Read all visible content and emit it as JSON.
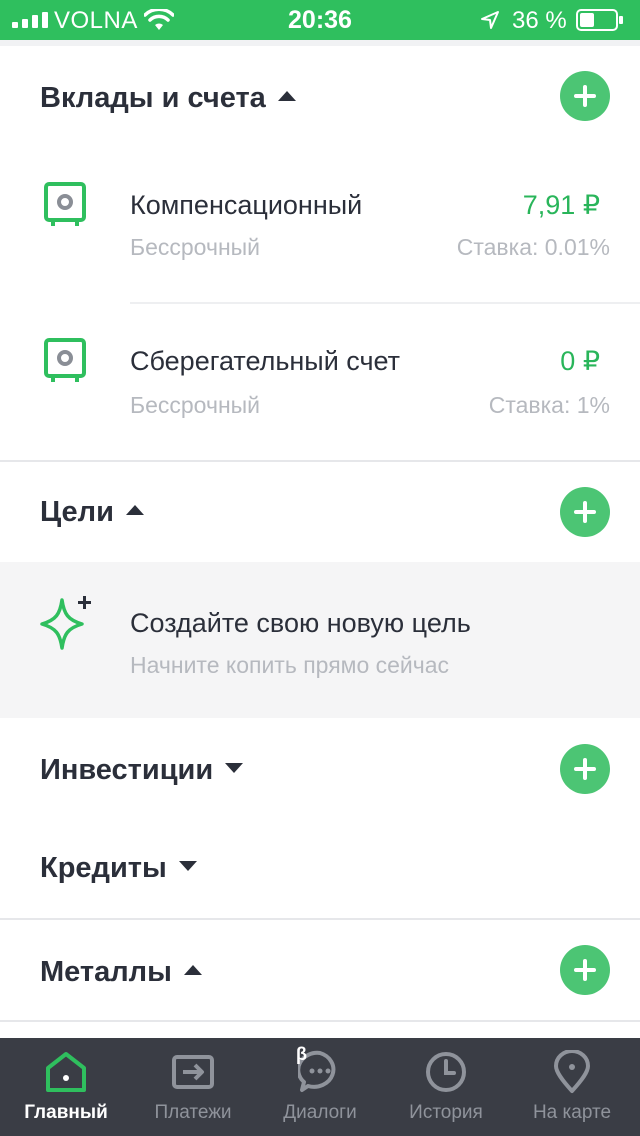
{
  "status_bar": {
    "carrier": "VOLNA",
    "time": "20:36",
    "battery": "36 %"
  },
  "sections": {
    "deposits": {
      "title": "Вклады и счета"
    },
    "goals": {
      "title": "Цели"
    },
    "investments": {
      "title": "Инвестиции"
    },
    "credits": {
      "title": "Кредиты"
    },
    "metals": {
      "title": "Металлы"
    }
  },
  "accounts": [
    {
      "name": "Компенсационный",
      "term": "Бессрочный",
      "amount": "7,91 ₽",
      "rate": "Ставка: 0.01%"
    },
    {
      "name": "Сберегательный счет",
      "term": "Бессрочный",
      "amount": "0 ₽",
      "rate": "Ставка: 1%"
    }
  ],
  "goal_card": {
    "title": "Создайте свою новую цель",
    "subtitle": "Начните копить прямо сейчас"
  },
  "tab_bar": {
    "tabs": [
      {
        "label": "Главный",
        "icon": "home-icon",
        "active": true
      },
      {
        "label": "Платежи",
        "icon": "payments-icon",
        "active": false
      },
      {
        "label": "Диалоги",
        "icon": "chat-icon",
        "active": false
      },
      {
        "label": "История",
        "icon": "clock-icon",
        "active": false
      },
      {
        "label": "На карте",
        "icon": "map-pin-icon",
        "active": false
      }
    ],
    "beta_badge": "β"
  },
  "colors": {
    "accent": "#2fbf5e",
    "add_button": "#4cc574",
    "amount": "#29b55a",
    "tab_bar": "#3a3d45"
  }
}
